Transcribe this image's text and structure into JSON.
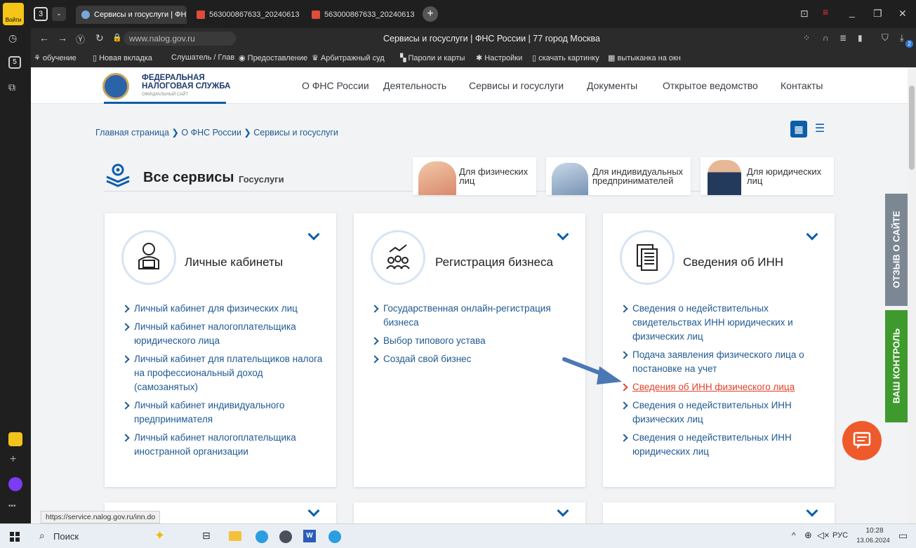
{
  "browser": {
    "login_label": "Войти",
    "tab_count": "3",
    "tabs": [
      {
        "title": "Сервисы и госуслуги | ФНС"
      },
      {
        "title": "563000867633_20240613"
      },
      {
        "title": "563000867633_20240613"
      }
    ],
    "url": "www.nalog.gov.ru",
    "page_title": "Сервисы и госуслуги | ФНС России | 77 город Москва",
    "download_badge": "2",
    "bookmarks": [
      "обучение",
      "Новая вкладка",
      "Слушатель / Глав",
      "Предоставление",
      "Арбитражный суд",
      "Пароли и карты",
      "Настройки",
      "скачать картинку",
      "вытыканка на окн"
    ],
    "side_counter": "5",
    "status_url": "https://service.nalog.gov.ru/inn.do"
  },
  "site": {
    "logo_line1": "ФЕДЕРАЛЬНАЯ",
    "logo_line2": "НАЛОГОВАЯ СЛУЖБА",
    "logo_line3": "ОФИЦИАЛЬНЫЙ САЙТ",
    "nav": [
      "О ФНС России",
      "Деятельность",
      "Сервисы и госуслуги",
      "Документы",
      "Открытое ведомство",
      "Контакты"
    ],
    "breadcrumb": [
      "Главная страница",
      "О ФНС России",
      "Сервисы и госуслуги"
    ],
    "section_title": "Все сервисы",
    "section_tab": "Госуслуги",
    "audiences": [
      "Для физических лиц",
      "Для индивидуальных предпринимателей",
      "Для юридических лиц"
    ],
    "side_feedback": "ОТЗЫВ О САЙТЕ",
    "side_control": "ВАШ КОНТРОЛЬ"
  },
  "cards": [
    {
      "title": "Личные кабинеты",
      "links": [
        "Личный кабинет для физических лиц",
        "Личный кабинет налогоплательщика юридического лица",
        "Личный кабинет для плательщиков налога на профессиональный доход (самозанятых)",
        "Личный кабинет индивидуального предпринимателя",
        "Личный кабинет налогоплательщика иностранной организации"
      ]
    },
    {
      "title": "Регистрация бизнеса",
      "links": [
        "Государственная онлайн-регистрация бизнеса",
        "Выбор типового устава",
        "Создай свой бизнес"
      ]
    },
    {
      "title": "Сведения об ИНН",
      "links": [
        "Сведения о недействительных свидетельствах ИНН юридических и физических лиц",
        "Подача заявления физического лица о постановке на учет",
        "Сведения об ИНН физического лица",
        "Сведения о недействительных ИНН физических лиц",
        "Сведения о недействительных ИНН юридических лиц"
      ]
    }
  ],
  "taskbar": {
    "search": "Поиск",
    "lang": "РУС",
    "time": "10:28",
    "date": "13.06.2024"
  },
  "colors": {
    "accent": "#0b5ea8",
    "highlight": "#e0412b",
    "green": "#3f9a2e"
  }
}
